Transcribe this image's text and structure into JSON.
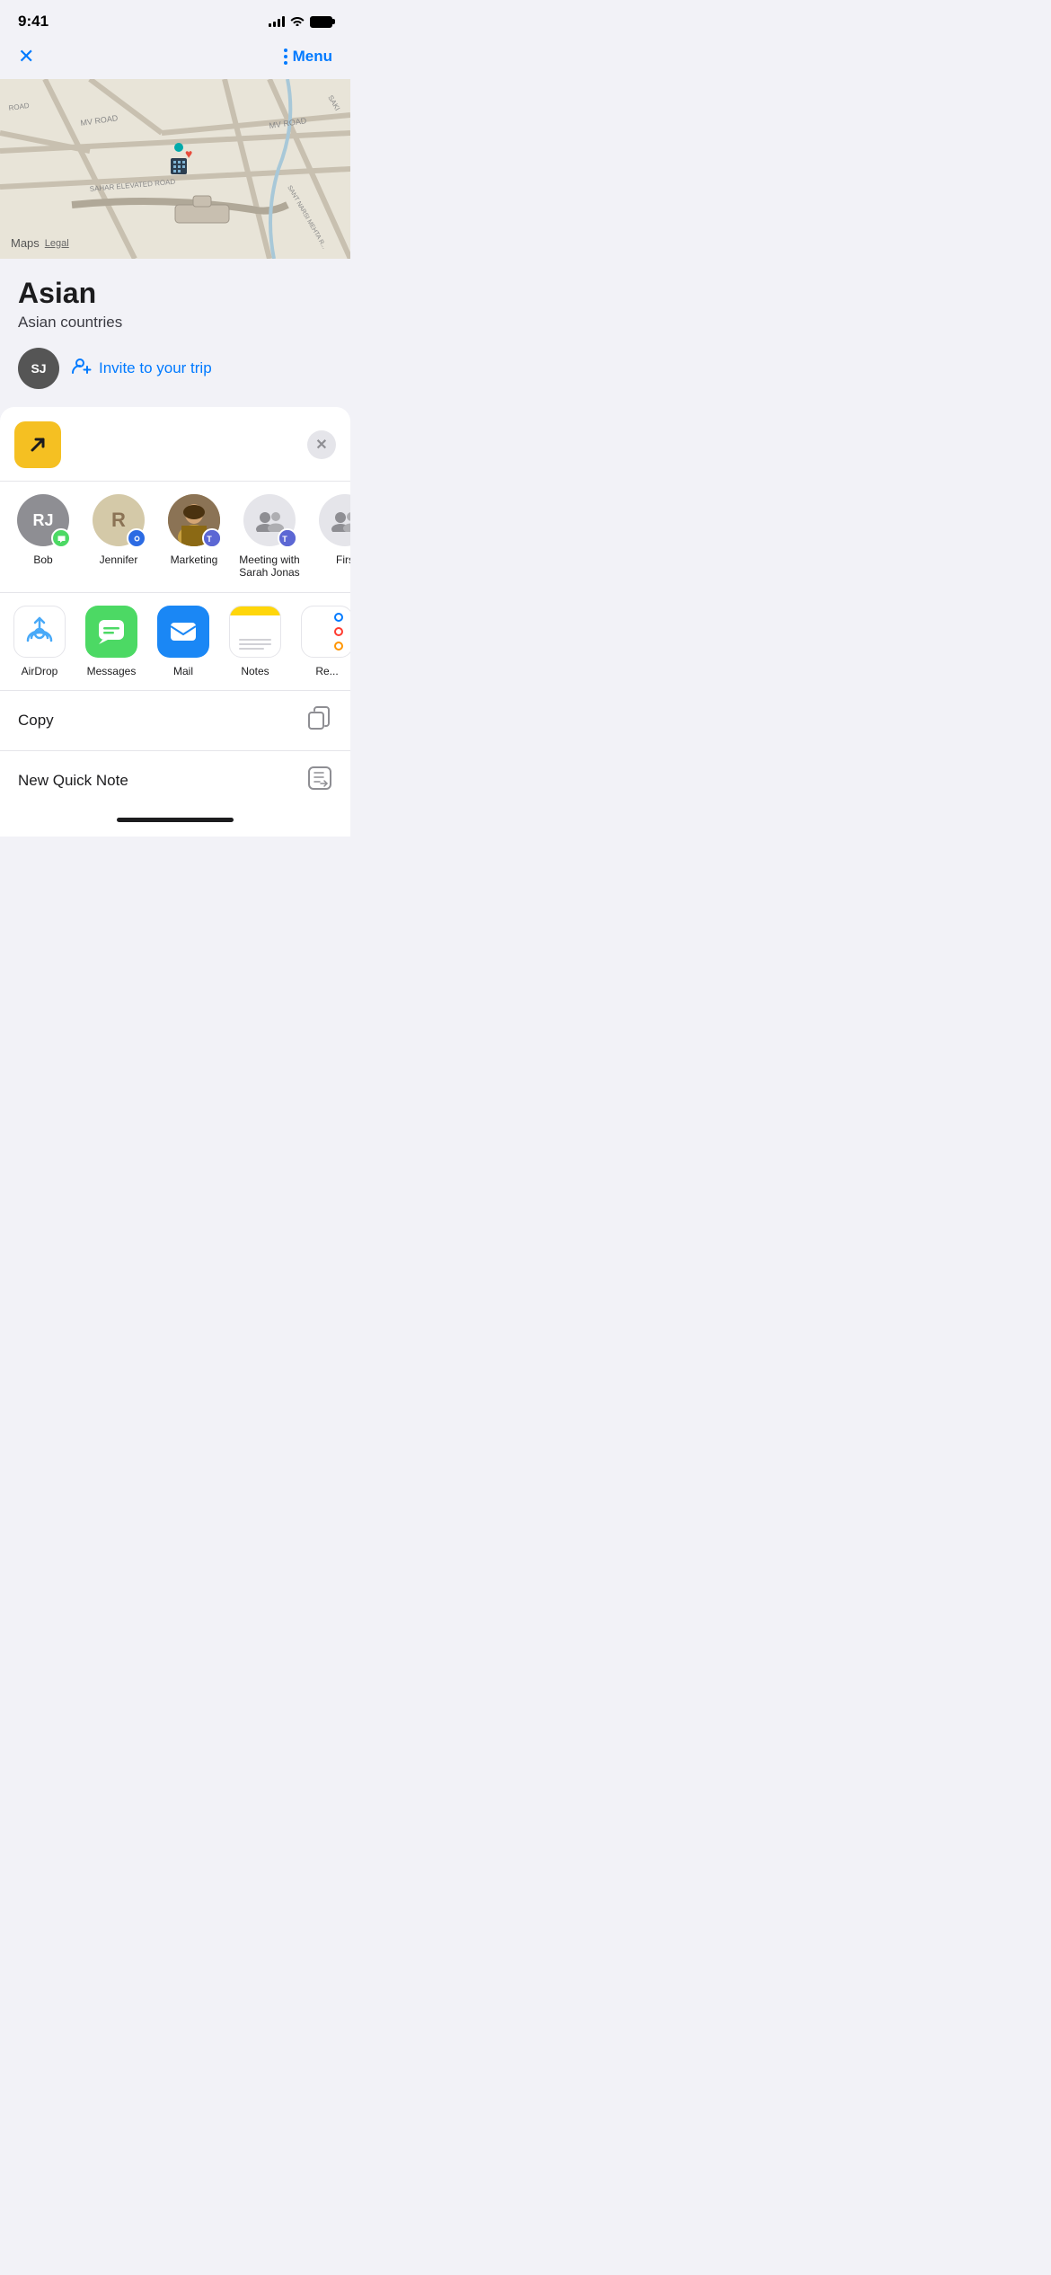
{
  "statusBar": {
    "time": "9:41",
    "battery": "full"
  },
  "topNav": {
    "closeLabel": "✕",
    "dotsLabel": "⋮",
    "menuLabel": "Menu"
  },
  "map": {
    "watermark": "Maps",
    "legal": "Legal"
  },
  "location": {
    "title": "Asian",
    "subtitle": "Asian countries",
    "avatar": "SJ",
    "inviteLabel": "Invite to your trip"
  },
  "shareSheet": {
    "closeLabel": "✕",
    "people": [
      {
        "id": "bob",
        "name": "Bob",
        "avatarText": "RJ",
        "badge": "messages"
      },
      {
        "id": "jennifer",
        "name": "Jennifer",
        "avatarText": "R",
        "badge": "signal"
      },
      {
        "id": "marketing",
        "name": "Marketing",
        "avatarText": "",
        "badge": "teams"
      },
      {
        "id": "meeting",
        "name": "Meeting with\nSarah Jonas",
        "avatarText": "👥",
        "badge": "teams"
      },
      {
        "id": "first",
        "name": "Firs",
        "avatarText": "👥",
        "badge": "teams"
      }
    ],
    "apps": [
      {
        "id": "airdrop",
        "name": "AirDrop"
      },
      {
        "id": "messages",
        "name": "Messages"
      },
      {
        "id": "mail",
        "name": "Mail"
      },
      {
        "id": "notes",
        "name": "Notes"
      },
      {
        "id": "reminders",
        "name": "Re..."
      }
    ],
    "actions": [
      {
        "id": "copy",
        "label": "Copy",
        "icon": "copy"
      },
      {
        "id": "new-quick-note",
        "label": "New Quick Note",
        "icon": "quick-note"
      }
    ]
  }
}
